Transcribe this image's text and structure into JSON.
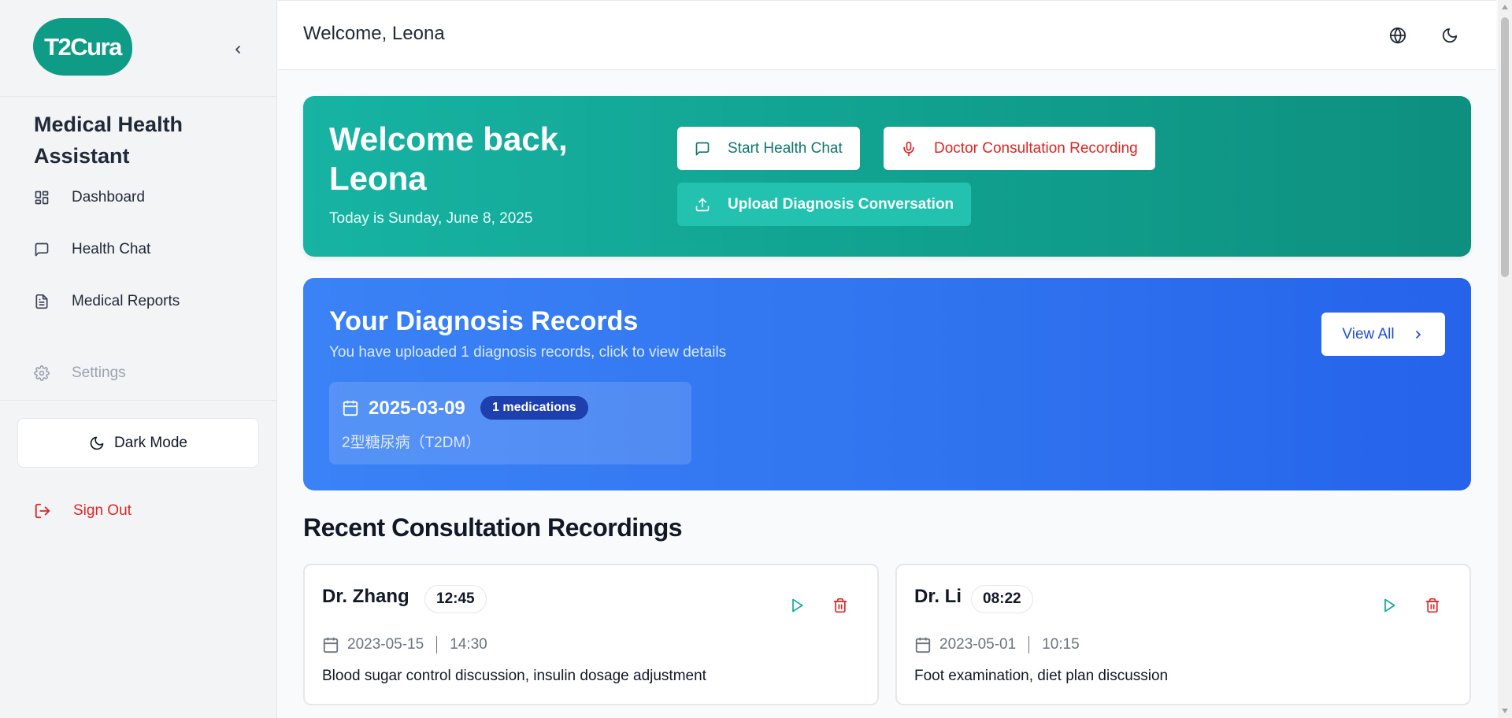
{
  "sidebar": {
    "logo_text": "T2Cura",
    "app_title": "Medical Health Assistant",
    "items": [
      {
        "label": "Dashboard",
        "icon": "dashboard-icon"
      },
      {
        "label": "Health Chat",
        "icon": "chat-icon"
      },
      {
        "label": "Medical Reports",
        "icon": "document-icon"
      },
      {
        "label": "Settings",
        "icon": "gear-icon"
      }
    ],
    "dark_mode_label": "Dark Mode",
    "sign_out_label": "Sign Out"
  },
  "header": {
    "welcome": "Welcome, Leona",
    "icons": [
      "globe-icon",
      "moon-icon"
    ]
  },
  "hero": {
    "title": "Welcome back, Leona",
    "date_text": "Today is Sunday, June 8, 2025",
    "buttons": {
      "health_chat": "Start Health Chat",
      "recording": "Doctor Consultation Recording",
      "upload": "Upload Diagnosis Conversation"
    }
  },
  "diagnosis": {
    "title": "Your Diagnosis Records",
    "subtitle": "You have uploaded 1 diagnosis records, click to view details",
    "view_all": "View All",
    "records": [
      {
        "date": "2025-03-09",
        "badge": "1 medications",
        "diagnosis": "2型糖尿病（T2DM）"
      }
    ]
  },
  "recordings": {
    "title": "Recent Consultation Recordings",
    "items": [
      {
        "doctor": "Dr. Zhang",
        "duration": "12:45",
        "date": "2023-05-15",
        "time": "14:30",
        "description": "Blood sugar control discussion, insulin dosage adjustment"
      },
      {
        "doctor": "Dr. Li",
        "duration": "08:22",
        "date": "2023-05-01",
        "time": "10:15",
        "description": "Foot examination, diet plan discussion"
      }
    ]
  },
  "colors": {
    "teal": "#14a896",
    "blue": "#3b82f6",
    "red": "#dc2626"
  }
}
